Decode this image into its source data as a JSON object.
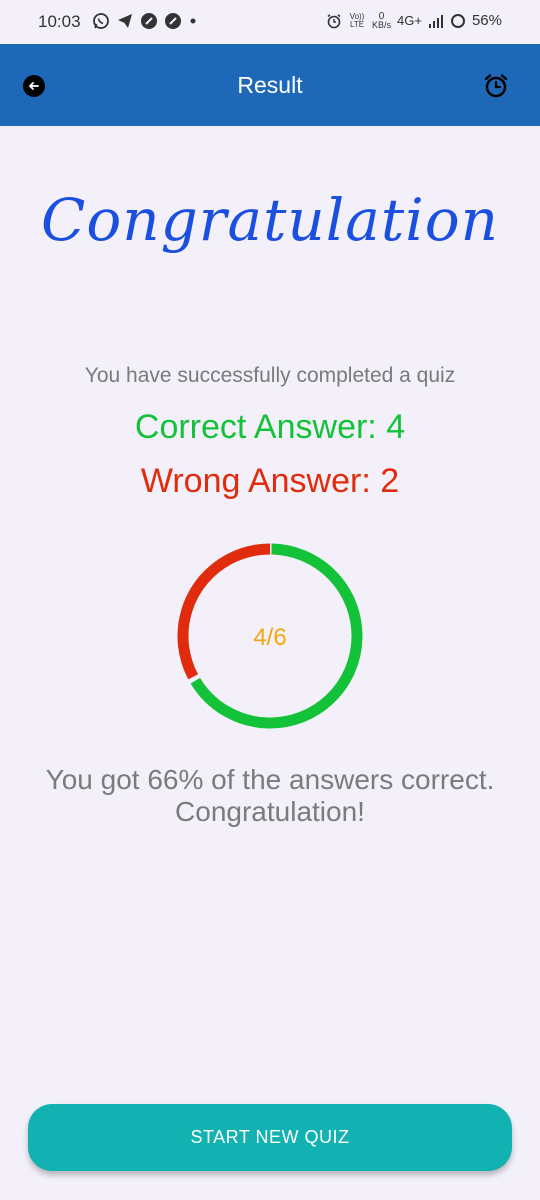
{
  "status_bar": {
    "time": "10:03",
    "volte": "Vo)) LTE",
    "data_rate_value": "0",
    "data_rate_unit": "KB/s",
    "network": "4G+",
    "battery": "56%"
  },
  "app_bar": {
    "title": "Result",
    "back_icon": "back-arrow-icon",
    "alarm_icon": "alarm-clock-icon"
  },
  "result": {
    "headline": "Congratulation",
    "subtitle": "You have successfully completed a quiz",
    "correct_label": "Correct Answer: 4",
    "wrong_label": "Wrong Answer: 2",
    "correct_count": 4,
    "wrong_count": 2,
    "total": 6,
    "ring_label": "4/6",
    "summary_line1": "You got 66% of the answers correct.",
    "summary_line2": "Congratulation!"
  },
  "colors": {
    "app_bar": "#1e68b8",
    "headline": "#1b4fe0",
    "correct": "#14c23a",
    "wrong": "#e02b0d",
    "ring_label": "#f5a70f",
    "button": "#12b2b2",
    "background": "#f3f0fa"
  },
  "actions": {
    "start_new_quiz": "START NEW QUIZ"
  }
}
